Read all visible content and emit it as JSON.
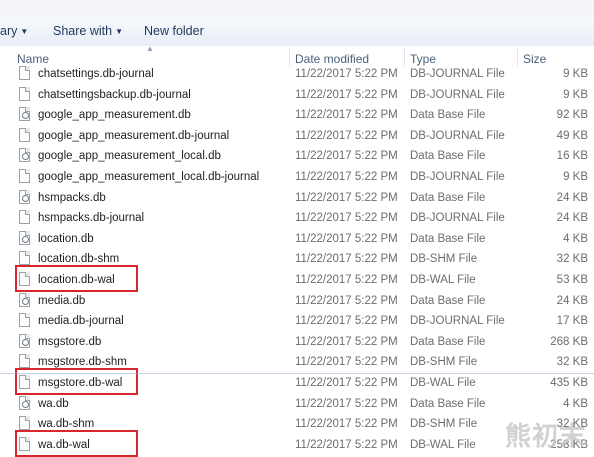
{
  "toolbar": {
    "library_label": "ary",
    "share_label": "Share with",
    "new_folder_label": "New folder"
  },
  "columns": {
    "name": "Name",
    "date": "Date modified",
    "type": "Type",
    "size": "Size"
  },
  "rows": [
    {
      "name": "chatsettings.db-journal",
      "date": "11/22/2017 5:22 PM",
      "type": "DB-JOURNAL File",
      "size": "9 KB",
      "icon": "file-icon",
      "highlighted": false
    },
    {
      "name": "chatsettingsbackup.db-journal",
      "date": "11/22/2017 5:22 PM",
      "type": "DB-JOURNAL File",
      "size": "9 KB",
      "icon": "file-icon",
      "highlighted": false
    },
    {
      "name": "google_app_measurement.db",
      "date": "11/22/2017 5:22 PM",
      "type": "Data Base File",
      "size": "92 KB",
      "icon": "database-file-icon",
      "highlighted": false
    },
    {
      "name": "google_app_measurement.db-journal",
      "date": "11/22/2017 5:22 PM",
      "type": "DB-JOURNAL File",
      "size": "49 KB",
      "icon": "file-icon",
      "highlighted": false
    },
    {
      "name": "google_app_measurement_local.db",
      "date": "11/22/2017 5:22 PM",
      "type": "Data Base File",
      "size": "16 KB",
      "icon": "database-file-icon",
      "highlighted": false
    },
    {
      "name": "google_app_measurement_local.db-journal",
      "date": "11/22/2017 5:22 PM",
      "type": "DB-JOURNAL File",
      "size": "9 KB",
      "icon": "file-icon",
      "highlighted": false
    },
    {
      "name": "hsmpacks.db",
      "date": "11/22/2017 5:22 PM",
      "type": "Data Base File",
      "size": "24 KB",
      "icon": "database-file-icon",
      "highlighted": false
    },
    {
      "name": "hsmpacks.db-journal",
      "date": "11/22/2017 5:22 PM",
      "type": "DB-JOURNAL File",
      "size": "24 KB",
      "icon": "file-icon",
      "highlighted": false
    },
    {
      "name": "location.db",
      "date": "11/22/2017 5:22 PM",
      "type": "Data Base File",
      "size": "4 KB",
      "icon": "database-file-icon",
      "highlighted": false
    },
    {
      "name": "location.db-shm",
      "date": "11/22/2017 5:22 PM",
      "type": "DB-SHM File",
      "size": "32 KB",
      "icon": "file-icon",
      "highlighted": false
    },
    {
      "name": "location.db-wal",
      "date": "11/22/2017 5:22 PM",
      "type": "DB-WAL File",
      "size": "53 KB",
      "icon": "file-icon",
      "highlighted": true
    },
    {
      "name": "media.db",
      "date": "11/22/2017 5:22 PM",
      "type": "Data Base File",
      "size": "24 KB",
      "icon": "database-file-icon",
      "highlighted": false
    },
    {
      "name": "media.db-journal",
      "date": "11/22/2017 5:22 PM",
      "type": "DB-JOURNAL File",
      "size": "17 KB",
      "icon": "file-icon",
      "highlighted": false
    },
    {
      "name": "msgstore.db",
      "date": "11/22/2017 5:22 PM",
      "type": "Data Base File",
      "size": "268 KB",
      "icon": "database-file-icon",
      "highlighted": false
    },
    {
      "name": "msgstore.db-shm",
      "date": "11/22/2017 5:22 PM",
      "type": "DB-SHM File",
      "size": "32 KB",
      "icon": "file-icon",
      "highlighted": false
    },
    {
      "name": "msgstore.db-wal",
      "date": "11/22/2017 5:22 PM",
      "type": "DB-WAL File",
      "size": "435 KB",
      "icon": "file-icon",
      "highlighted": true
    },
    {
      "name": "wa.db",
      "date": "11/22/2017 5:22 PM",
      "type": "Data Base File",
      "size": "4 KB",
      "icon": "database-file-icon",
      "highlighted": false
    },
    {
      "name": "wa.db-shm",
      "date": "11/22/2017 5:22 PM",
      "type": "DB-SHM File",
      "size": "32 KB",
      "icon": "file-icon",
      "highlighted": false
    },
    {
      "name": "wa.db-wal",
      "date": "11/22/2017 5:22 PM",
      "type": "DB-WAL File",
      "size": "258 KB",
      "icon": "file-icon",
      "highlighted": true
    }
  ],
  "watermark": "熊初末",
  "colors": {
    "highlight": "#d8262d",
    "toolbar_text": "#1e395b",
    "header_text": "#4c607a"
  }
}
